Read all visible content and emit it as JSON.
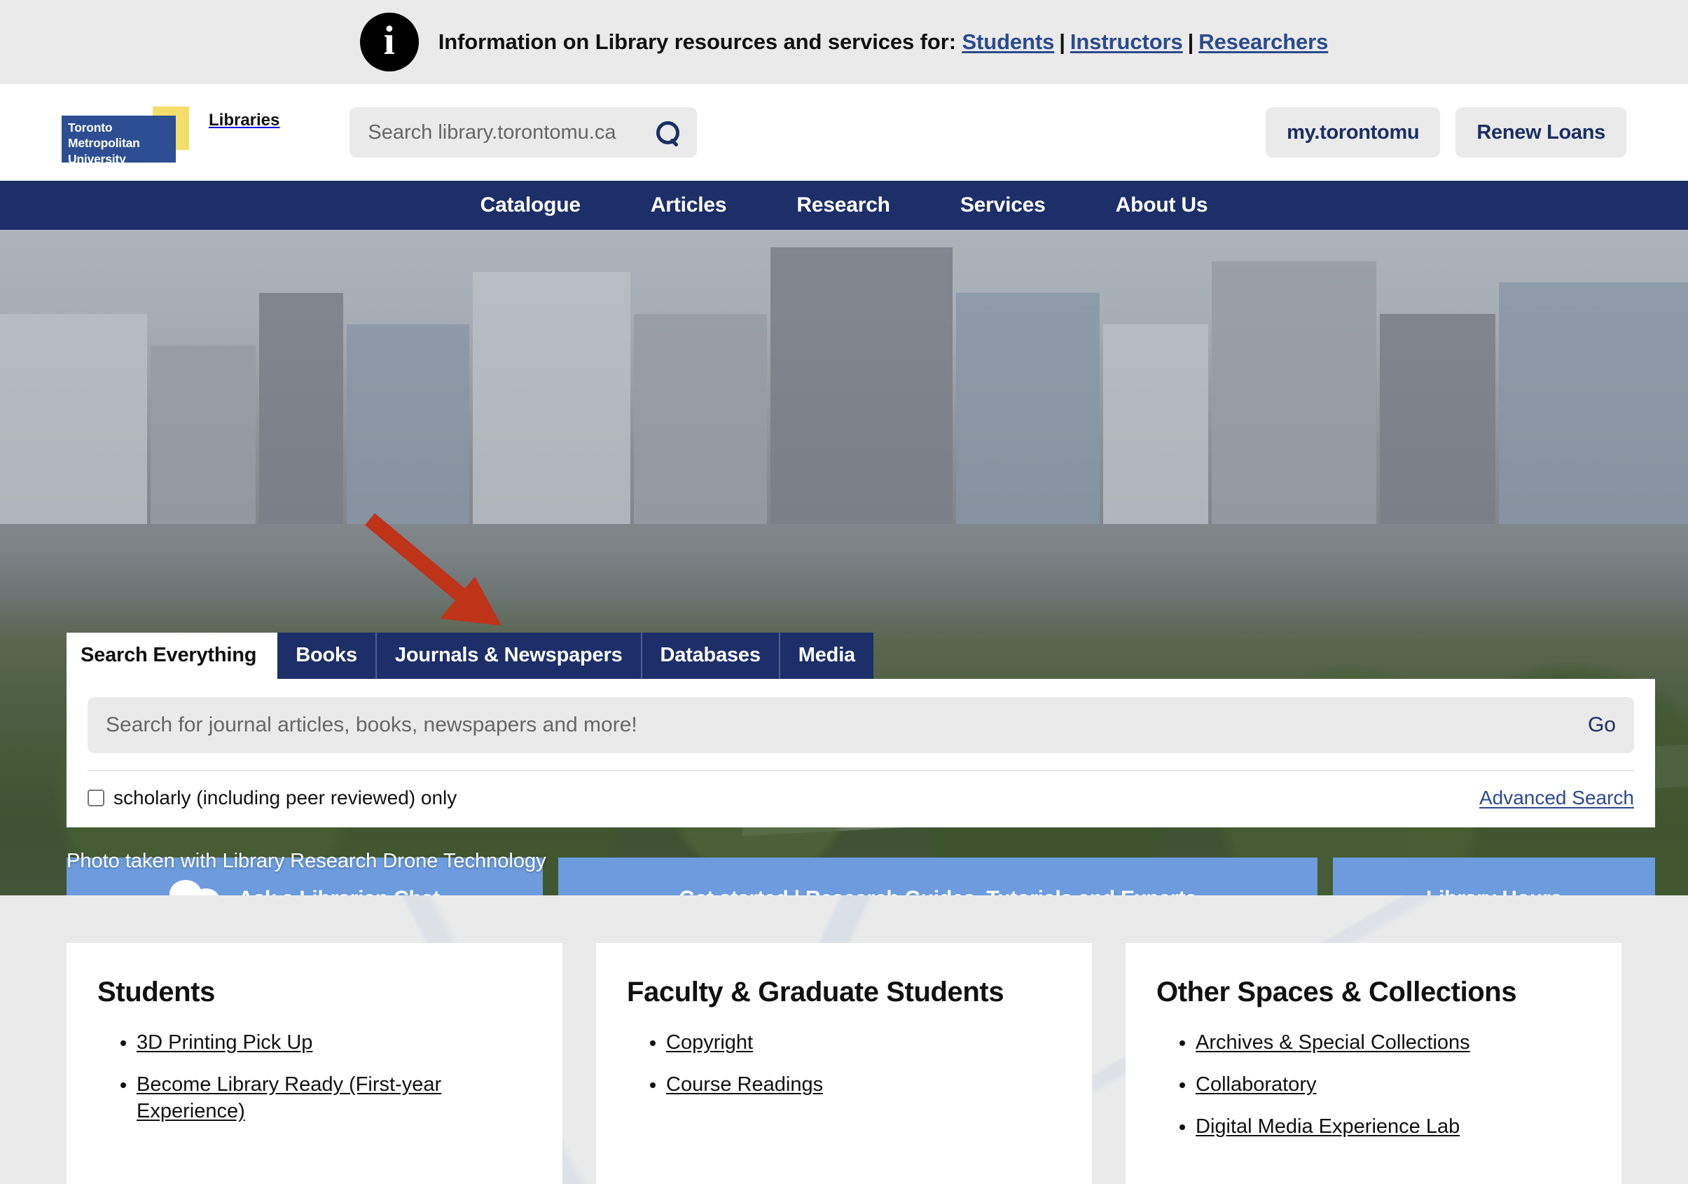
{
  "alert": {
    "icon": "info-icon",
    "text_prefix": "Information on Library resources and services for:",
    "links": [
      "Students",
      "Instructors",
      "Researchers"
    ],
    "separator": "|",
    "link_color": "#2a4a8f",
    "background": "#eaeaea"
  },
  "header": {
    "logo": {
      "line1": "Toronto",
      "line2": "Metropolitan",
      "line3": "University",
      "blue": "#2d4e92",
      "yellow": "#f4de6b"
    },
    "libraries_label": "Libraries",
    "search": {
      "placeholder": "Search library.torontomu.ca",
      "value": "",
      "icon": "search-icon"
    },
    "buttons": [
      {
        "label": "my.torontomu"
      },
      {
        "label": "Renew Loans"
      }
    ]
  },
  "nav": {
    "background": "#1c2f68",
    "items": [
      {
        "label": "Catalogue"
      },
      {
        "label": "Articles"
      },
      {
        "label": "Research"
      },
      {
        "label": "Services"
      },
      {
        "label": "About Us"
      }
    ]
  },
  "hero": {
    "caption": "Photo taken with Library Research Drone Technology",
    "annotation": {
      "type": "arrow",
      "color": "#bf3319",
      "points_to": "Journals & Newspapers"
    },
    "search_panel": {
      "tabs": [
        {
          "label": "Search Everything",
          "active": true
        },
        {
          "label": "Books",
          "active": false
        },
        {
          "label": "Journals & Newspapers",
          "active": false
        },
        {
          "label": "Databases",
          "active": false
        },
        {
          "label": "Media",
          "active": false
        }
      ],
      "input": {
        "placeholder": "Search for journal articles, books, newspapers and more!",
        "value": ""
      },
      "go_label": "Go",
      "scholarly_label": "scholarly (including peer reviewed) only",
      "scholarly_checked": false,
      "advanced_search_label": "Advanced Search"
    },
    "ctas": [
      {
        "label": "Ask a Librarian Chat",
        "icon": "chat-bubbles-icon"
      },
      {
        "label": "Get started | Research Guides, Tutorials and Experts",
        "icon": ""
      },
      {
        "label": "Library Hours",
        "icon": ""
      }
    ],
    "cta_color": "#6c9cdd"
  },
  "cards": [
    {
      "title": "Students",
      "links": [
        "3D Printing Pick Up",
        "Become Library Ready (First-year Experience)"
      ]
    },
    {
      "title": "Faculty & Graduate Students",
      "links": [
        "Copyright",
        "Course Readings"
      ]
    },
    {
      "title": "Other Spaces & Collections",
      "links": [
        "Archives & Special Collections",
        "Collaboratory",
        "Digital Media Experience Lab"
      ]
    }
  ]
}
